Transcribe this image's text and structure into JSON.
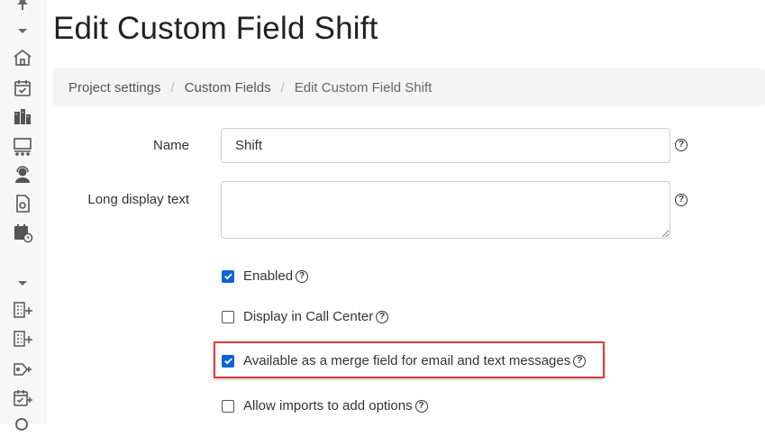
{
  "page": {
    "title": "Edit Custom Field Shift"
  },
  "breadcrumb": {
    "items": [
      "Project settings",
      "Custom Fields",
      "Edit Custom Field Shift"
    ],
    "separator": "/"
  },
  "form": {
    "name": {
      "label": "Name",
      "value": "Shift",
      "help": "?"
    },
    "long_display_text": {
      "label": "Long display text",
      "value": "",
      "help": "?"
    },
    "checkboxes": [
      {
        "label": "Enabled",
        "checked": true,
        "help": "?"
      },
      {
        "label": "Display in Call Center",
        "checked": false,
        "help": "?"
      },
      {
        "label": "Available as a merge field for email and text messages",
        "checked": true,
        "help": "?",
        "highlighted": true
      },
      {
        "label": "Allow imports to add options",
        "checked": false,
        "help": "?"
      }
    ]
  },
  "sidebar": {
    "icons": [
      "pin-icon",
      "collapse-arrow-icon",
      "home-icon",
      "calendar-check-icon",
      "buildings-icon",
      "presentation-icon",
      "support-agent-icon",
      "document-icon",
      "calendar-clock-icon",
      "collapse-arrow-icon",
      "add-building-icon",
      "add-building-icon",
      "add-tag-icon",
      "add-calendar-icon",
      "search-icon"
    ]
  },
  "colors": {
    "accent": "#0b64d8",
    "highlight": "#e0393b",
    "sidebar_bg": "#f7f7f7",
    "breadcrumb_bg": "#f4f4f4"
  }
}
